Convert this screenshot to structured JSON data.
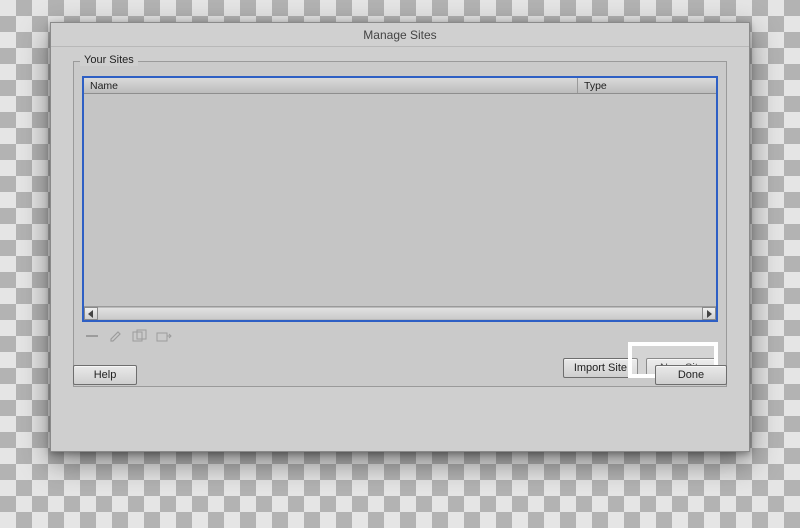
{
  "dialog": {
    "title": "Manage Sites"
  },
  "group": {
    "label": "Your Sites"
  },
  "table": {
    "columns": {
      "name": "Name",
      "type": "Type"
    }
  },
  "toolbar_icons": {
    "delete": "delete-icon",
    "edit": "edit-icon",
    "duplicate": "duplicate-icon",
    "export": "export-icon"
  },
  "buttons": {
    "import": "Import Site",
    "new": "New Site",
    "help": "Help",
    "done": "Done"
  }
}
